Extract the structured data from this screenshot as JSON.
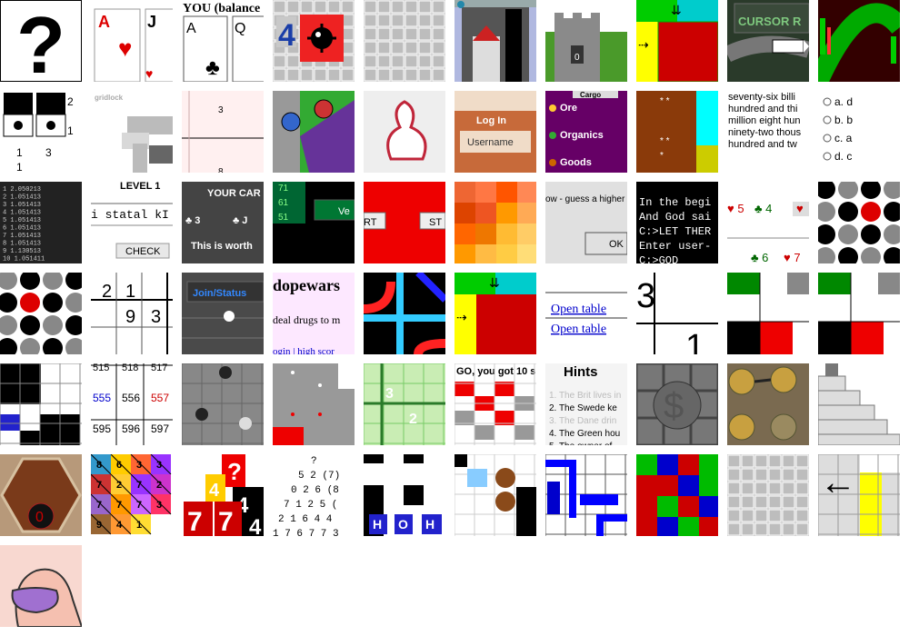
{
  "page": {
    "title": ""
  },
  "tiles": [
    {
      "id": "question-mark",
      "text": [
        "?"
      ]
    },
    {
      "id": "card-ace-hearts",
      "text": [
        "A",
        "♥",
        "J",
        "♥"
      ]
    },
    {
      "id": "card-balance",
      "text": [
        "YOU (balance",
        "A",
        "♣",
        "Q"
      ]
    },
    {
      "id": "minesweeper-4",
      "text": [
        "4"
      ]
    },
    {
      "id": "grey-grid",
      "text": []
    },
    {
      "id": "castle-blue",
      "text": []
    },
    {
      "id": "castle-zero",
      "text": [
        "0"
      ]
    },
    {
      "id": "color-arrows",
      "text": [
        "⇊",
        "⇢"
      ]
    },
    {
      "id": "cursor-race",
      "text": [
        "CURSOR R"
      ]
    },
    {
      "id": "red-green-bars",
      "text": []
    },
    {
      "id": "black-squares-dots",
      "text": [
        "2",
        "1",
        "1",
        "3",
        "1"
      ]
    },
    {
      "id": "gridlock",
      "text": [
        "gridlock"
      ]
    },
    {
      "id": "pink-sudoku",
      "text": [
        "3",
        "8"
      ]
    },
    {
      "id": "green-blob",
      "text": []
    },
    {
      "id": "pink-pinup",
      "text": []
    },
    {
      "id": "login",
      "text": [
        "Log In",
        "Username"
      ]
    },
    {
      "id": "cargo",
      "text": [
        "Cargo",
        "Ore",
        "Organics",
        "Goods"
      ]
    },
    {
      "id": "brown-stars",
      "text": [
        "* *",
        "* *",
        "*"
      ]
    },
    {
      "id": "number-text",
      "text": [
        "seventy-six billi",
        "hundred and thi",
        "million eight hun",
        "ninety-two thous",
        "hundred and tw"
      ]
    },
    {
      "id": "radio-quiz",
      "text": [
        "a. d",
        "b. b",
        "c. a",
        "d. c"
      ]
    },
    {
      "id": "stats-list",
      "text": [
        "1 2.050213",
        "2 1.051413",
        "3 1.051413",
        "4 1.051413",
        "5 1.051413",
        "6 1.051413",
        "7 1.051413",
        "8 1.051413",
        "9 1.130513",
        "10 1.051411"
      ]
    },
    {
      "id": "level1",
      "text": [
        "LEVEL 1",
        "i statal kI",
        "CHECK"
      ]
    },
    {
      "id": "your-cards",
      "text": [
        "YOUR CAR",
        "♣ 3",
        "♣ J",
        "This is worth"
      ]
    },
    {
      "id": "green-numbers",
      "text": [
        "71",
        "61",
        "51",
        "Ve"
      ]
    },
    {
      "id": "red-buttons",
      "text": [
        "RT",
        "ST"
      ]
    },
    {
      "id": "orange-gradient",
      "text": []
    },
    {
      "id": "guess-higher",
      "text": [
        "ow - guess a higher",
        "OK"
      ]
    },
    {
      "id": "terminal",
      "text": [
        "In the begi",
        "And God sai",
        "C:>LET THER",
        "Enter user-",
        "C:>GOD"
      ]
    },
    {
      "id": "card-values",
      "text": [
        "♥ 5",
        "♣ 4",
        "♥",
        "♣ 6",
        "♥ 7"
      ]
    },
    {
      "id": "circle-grid-a",
      "text": []
    },
    {
      "id": "circle-grid-b",
      "text": []
    },
    {
      "id": "sudoku-numbers",
      "text": [
        "2",
        "1",
        "9",
        "3"
      ]
    },
    {
      "id": "join-status",
      "text": [
        "Join/Status"
      ]
    },
    {
      "id": "dopewars",
      "text": [
        "dopewars",
        "deal drugs to m",
        "ogin | high scor"
      ]
    },
    {
      "id": "neon-pipes",
      "text": []
    },
    {
      "id": "color-arrows-b",
      "text": [
        "⇊",
        "⇢"
      ]
    },
    {
      "id": "open-table",
      "text": [
        "Open table",
        "Open table"
      ]
    },
    {
      "id": "number-3-1",
      "text": [
        "3",
        "1"
      ]
    },
    {
      "id": "green-red-blocks",
      "text": []
    },
    {
      "id": "green-red-blocks-b",
      "text": []
    },
    {
      "id": "tetris-blue",
      "text": []
    },
    {
      "id": "number-grid",
      "text": [
        "515",
        "518",
        "517",
        "555",
        "556",
        "557",
        "595",
        "596",
        "597"
      ]
    },
    {
      "id": "grey-spheres",
      "text": []
    },
    {
      "id": "grey-board",
      "text": []
    },
    {
      "id": "green-sudoku",
      "text": [
        "3",
        "2"
      ]
    },
    {
      "id": "go-tiles",
      "text": [
        "GO, you got 10 s"
      ]
    },
    {
      "id": "hints",
      "text": [
        "Hints",
        "1. The Brit lives in",
        "2. The Swede ke",
        "3. The Dane drin",
        "4. The Green hou",
        "5. The owner of"
      ]
    },
    {
      "id": "metal-puzzle",
      "text": []
    },
    {
      "id": "brass-puzzle",
      "text": []
    },
    {
      "id": "staircase",
      "text": []
    },
    {
      "id": "hex-board",
      "text": [
        "0"
      ]
    },
    {
      "id": "triangle-puzzle",
      "text": [
        "8",
        "6",
        "3",
        "3",
        "7",
        "2",
        "7",
        "2",
        "7",
        "7",
        "7",
        "3",
        "9",
        "4",
        "1"
      ]
    },
    {
      "id": "card-sevens",
      "text": [
        "?",
        "4",
        "4",
        "7",
        "7",
        "4"
      ]
    },
    {
      "id": "number-pyramid",
      "text": [
        "?",
        "5 2 (7)",
        "0 2 6 (8",
        "7 1 2 5 (",
        "2 1 6 4 4",
        "1 7 6 7 7 3"
      ]
    },
    {
      "id": "hoh-blocks",
      "text": [
        "H",
        "O",
        "H"
      ]
    },
    {
      "id": "brown-circles",
      "text": []
    },
    {
      "id": "blue-pipes",
      "text": []
    },
    {
      "id": "rgb-blocks",
      "text": []
    },
    {
      "id": "grey-grid-b",
      "text": []
    },
    {
      "id": "arrow-yellow",
      "text": [
        "←"
      ]
    },
    {
      "id": "purple-pinup",
      "text": []
    }
  ]
}
